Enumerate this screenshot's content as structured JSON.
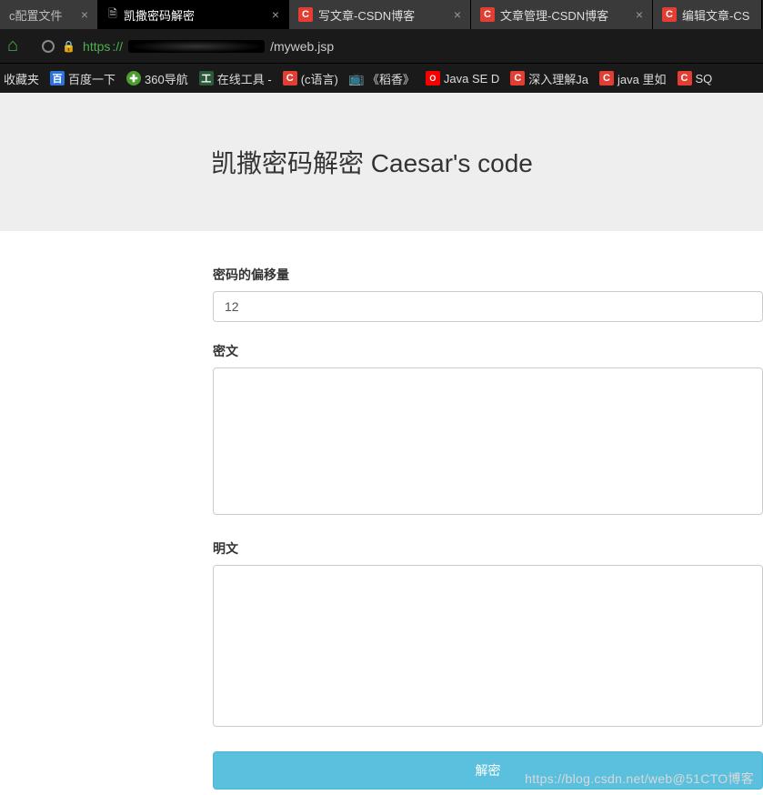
{
  "tabs": [
    {
      "title": "c配置文件",
      "icon": "page"
    },
    {
      "title": "凯撒密码解密",
      "icon": "page",
      "active": true
    },
    {
      "title": "写文章-CSDN博客",
      "icon": "csdn"
    },
    {
      "title": "文章管理-CSDN博客",
      "icon": "csdn"
    },
    {
      "title": "编辑文章-CS",
      "icon": "csdn"
    }
  ],
  "url": {
    "protocol": "https",
    "protocol_suffix": "://",
    "path": "/myweb.jsp"
  },
  "bookmarks": {
    "favorites": "收藏夹",
    "baidu": "百度一下",
    "nav360": "360导航",
    "tools": "在线工具 -",
    "clang": "(c语言)",
    "daoxiang": "《稻香》",
    "javase": "Java SE D",
    "javadeep": "深入理解Ja",
    "javain": "java 里如",
    "sq": "SQ"
  },
  "page": {
    "title": "凯撒密码解密 Caesar's code"
  },
  "form": {
    "offset_label": "密码的偏移量",
    "offset_value": "12",
    "cipher_label": "密文",
    "cipher_value": "",
    "plain_label": "明文",
    "plain_value": "",
    "decrypt_button": "解密"
  },
  "watermark": "https://blog.csdn.net/web@51CTO博客"
}
